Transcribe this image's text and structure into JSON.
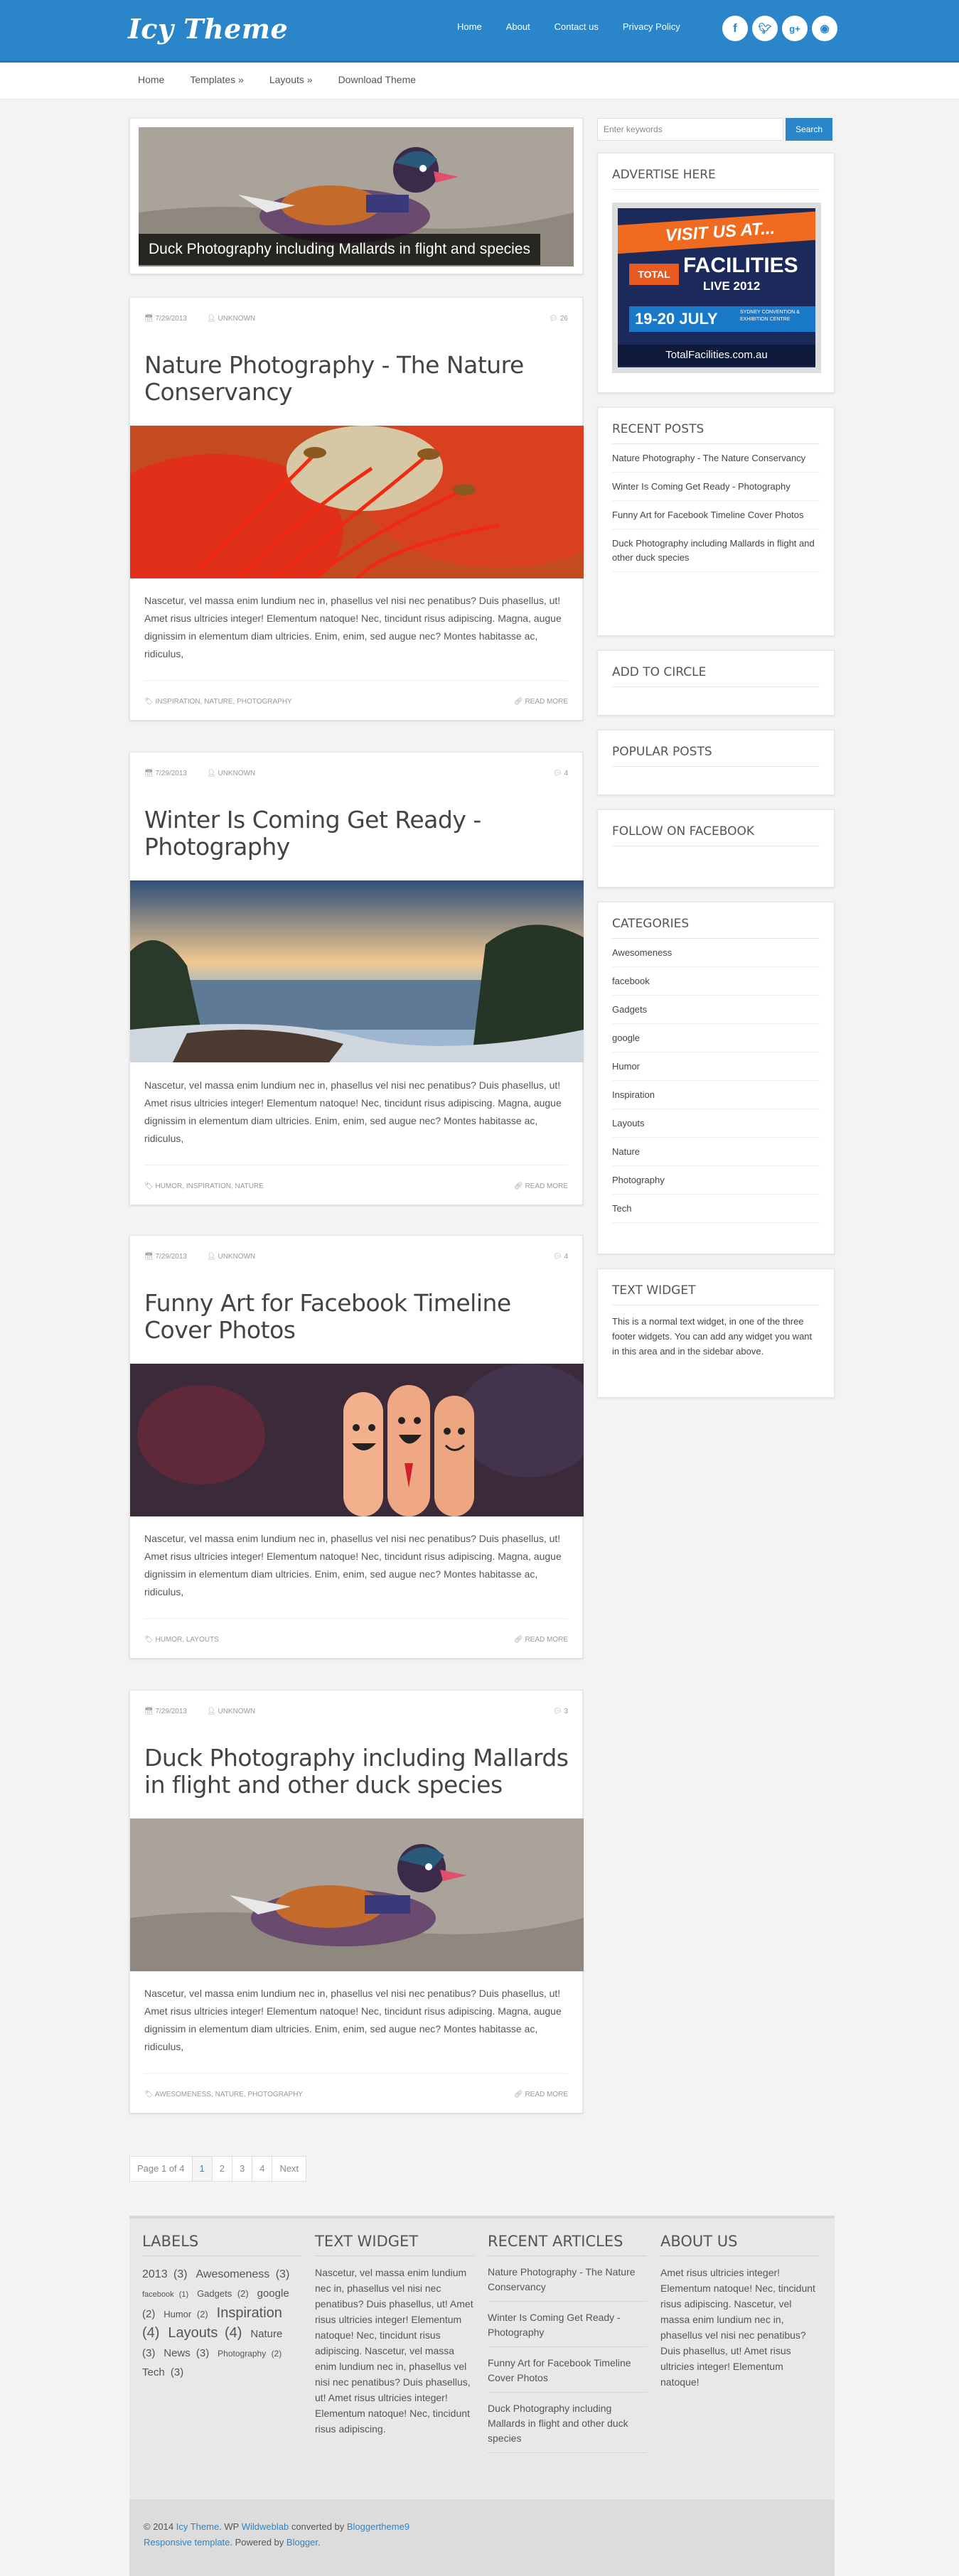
{
  "header": {
    "logo": "Icy Theme",
    "nav": [
      "Home",
      "About",
      "Contact us",
      "Privacy Policy"
    ],
    "social": [
      "f",
      "t",
      "g+",
      "rss"
    ]
  },
  "menu": [
    "Home",
    "Templates »",
    "Layouts »",
    "Download Theme"
  ],
  "featured": {
    "caption": "Duck Photography including Mallards in flight and species"
  },
  "posts": [
    {
      "date": "7/29/2013",
      "author": "UNKNOWN",
      "comments": "26",
      "title": "Nature Photography - The Nature Conservancy",
      "excerpt": "Nascetur, vel massa enim lundium nec in, phasellus vel nisi nec penatibus? Duis phasellus, ut! Amet risus ultricies integer! Elementum natoque! Nec, tincidunt risus adipiscing. Magna, augue dignissim in elementum diam ultricies. Enim, enim, sed augue nec? Montes habitasse ac, ridiculus,",
      "tags": "INSPIRATION, NATURE, PHOTOGRAPHY",
      "more": "READ MORE"
    },
    {
      "date": "7/29/2013",
      "author": "UNKNOWN",
      "comments": "4",
      "title": "Winter Is Coming Get Ready - Photography",
      "excerpt": "Nascetur, vel massa enim lundium nec in, phasellus vel nisi nec penatibus? Duis phasellus, ut! Amet risus ultricies integer! Elementum natoque! Nec, tincidunt risus adipiscing. Magna, augue dignissim in elementum diam ultricies. Enim, enim, sed augue nec? Montes habitasse ac, ridiculus,",
      "tags": "HUMOR, INSPIRATION, NATURE",
      "more": "READ MORE"
    },
    {
      "date": "7/29/2013",
      "author": "UNKNOWN",
      "comments": "4",
      "title": "Funny Art for Facebook Timeline Cover Photos",
      "excerpt": "Nascetur, vel massa enim lundium nec in, phasellus vel nisi nec penatibus? Duis phasellus, ut! Amet risus ultricies integer! Elementum natoque! Nec, tincidunt risus adipiscing. Magna, augue dignissim in elementum diam ultricies. Enim, enim, sed augue nec? Montes habitasse ac, ridiculus,",
      "tags": "HUMOR, LAYOUTS",
      "more": "READ MORE"
    },
    {
      "date": "7/29/2013",
      "author": "UNKNOWN",
      "comments": "3",
      "title": "Duck Photography including Mallards in flight and other duck species",
      "excerpt": "Nascetur, vel massa enim lundium nec in, phasellus vel nisi nec penatibus? Duis phasellus, ut! Amet risus ultricies integer! Elementum natoque! Nec, tincidunt risus adipiscing. Magna, augue dignissim in elementum diam ultricies. Enim, enim, sed augue nec? Montes habitasse ac, ridiculus,",
      "tags": "AWESOMENESS, NATURE, PHOTOGRAPHY",
      "more": "READ MORE"
    }
  ],
  "pager": {
    "label": "Page 1 of 4",
    "pages": [
      "1",
      "2",
      "3",
      "4"
    ],
    "next": "Next"
  },
  "sidebar": {
    "search_placeholder": "Enter keywords",
    "search_button": "Search",
    "advertise": {
      "title": "ADVERTISE HERE",
      "banner_lines": [
        "VISIT US AT...",
        "TOTAL",
        "FACILITIES",
        "LIVE 2012",
        "19-20 JULY",
        "SYDNEY CONVENTION & EXHIBITION CENTRE",
        "TotalFacilities.com.au"
      ]
    },
    "recent_title": "RECENT POSTS",
    "recent": [
      "Nature Photography - The Nature Conservancy",
      "Winter Is Coming Get Ready - Photography",
      "Funny Art for Facebook Timeline Cover Photos",
      "Duck Photography including Mallards in flight and other duck species"
    ],
    "circle_title": "ADD TO CIRCLE",
    "popular_title": "POPULAR POSTS",
    "facebook_title": "FOLLOW ON FACEBOOK",
    "categories_title": "CATEGORIES",
    "categories": [
      "Awesomeness",
      "facebook",
      "Gadgets",
      "google",
      "Humor",
      "Inspiration",
      "Layouts",
      "Nature",
      "Photography",
      "Tech"
    ],
    "text_widget_title": "TEXT WIDGET",
    "text_widget": "This is a normal text widget, in one of the three footer widgets. You can add any widget you want in this area and in the sidebar above."
  },
  "footer": {
    "labels_title": "LABELS",
    "labels": [
      {
        "name": "2013",
        "count": "(3)",
        "size": 16
      },
      {
        "name": "Awesomeness",
        "count": "(3)",
        "size": 16
      },
      {
        "name": "facebook",
        "count": "(1)",
        "size": 11
      },
      {
        "name": "Gadgets",
        "count": "(2)",
        "size": 13
      },
      {
        "name": "google",
        "count": "(2)",
        "size": 14
      },
      {
        "name": "Humor",
        "count": "(2)",
        "size": 13
      },
      {
        "name": "Inspiration",
        "count": "(4)",
        "size": 20
      },
      {
        "name": "Layouts",
        "count": "(4)",
        "size": 20
      },
      {
        "name": "Nature",
        "count": "(3)",
        "size": 16
      },
      {
        "name": "News",
        "count": "(3)",
        "size": 16
      },
      {
        "name": "Photography",
        "count": "(2)",
        "size": 12
      },
      {
        "name": "Tech",
        "count": "(3)",
        "size": 15
      }
    ],
    "text_title": "TEXT WIDGET",
    "text": "Nascetur, vel massa enim lundium nec in, phasellus vel nisi nec penatibus? Duis phasellus, ut! Amet risus ultricies integer! Elementum natoque! Nec, tincidunt risus adipiscing. Nascetur, vel massa enim lundium nec in, phasellus vel nisi nec penatibus? Duis phasellus, ut! Amet risus ultricies integer! Elementum natoque! Nec, tincidunt risus adipiscing.",
    "recent_title": "RECENT ARTICLES",
    "recent": [
      "Nature Photography - The Nature Conservancy",
      "Winter Is Coming Get Ready - Photography",
      "Funny Art for Facebook Timeline Cover Photos",
      "Duck Photography including Mallards in flight and other duck species"
    ],
    "about_title": "ABOUT US",
    "about": "Amet risus ultricies integer! Elementum natoque! Nec, tincidunt risus adipiscing. Nascetur, vel massa enim lundium nec in, phasellus vel nisi nec penatibus? Duis phasellus, ut! Amet risus ultricies integer! Elementum natoque!",
    "copyright": {
      "prefix": "© 2014 ",
      "site": "Icy Theme",
      "wp": ". WP ",
      "wp_author": "Wildweblab",
      "converted": " converted by ",
      "converter": "Bloggertheme9",
      "responsive": "Responsive template",
      "powered": ". Powered by ",
      "blogger": "Blogger",
      "end": "."
    }
  }
}
